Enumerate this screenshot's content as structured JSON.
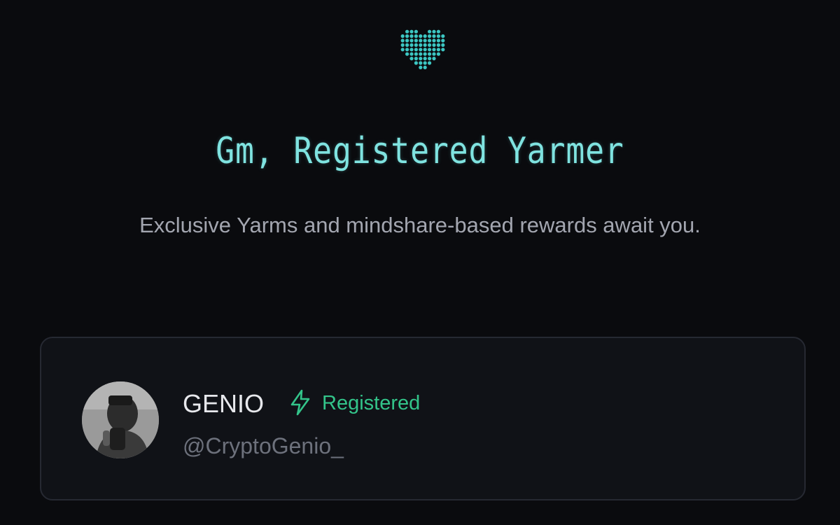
{
  "header": {
    "icon": "pixel-heart-icon",
    "title": "Gm, Registered Yarmer",
    "subtitle": "Exclusive Yarms and mindshare-based rewards await you."
  },
  "profile": {
    "name": "GENIO",
    "status_icon": "lightning-bolt-icon",
    "status": "Registered",
    "handle": "@CryptoGenio_"
  },
  "colors": {
    "background": "#0a0b0e",
    "card_background": "#101217",
    "title": "#7fe3e0",
    "subtitle": "#a3a6b0",
    "heart": "#3cc6c2",
    "name": "#e7e8ec",
    "status": "#33c48a",
    "handle": "#6d717c"
  }
}
